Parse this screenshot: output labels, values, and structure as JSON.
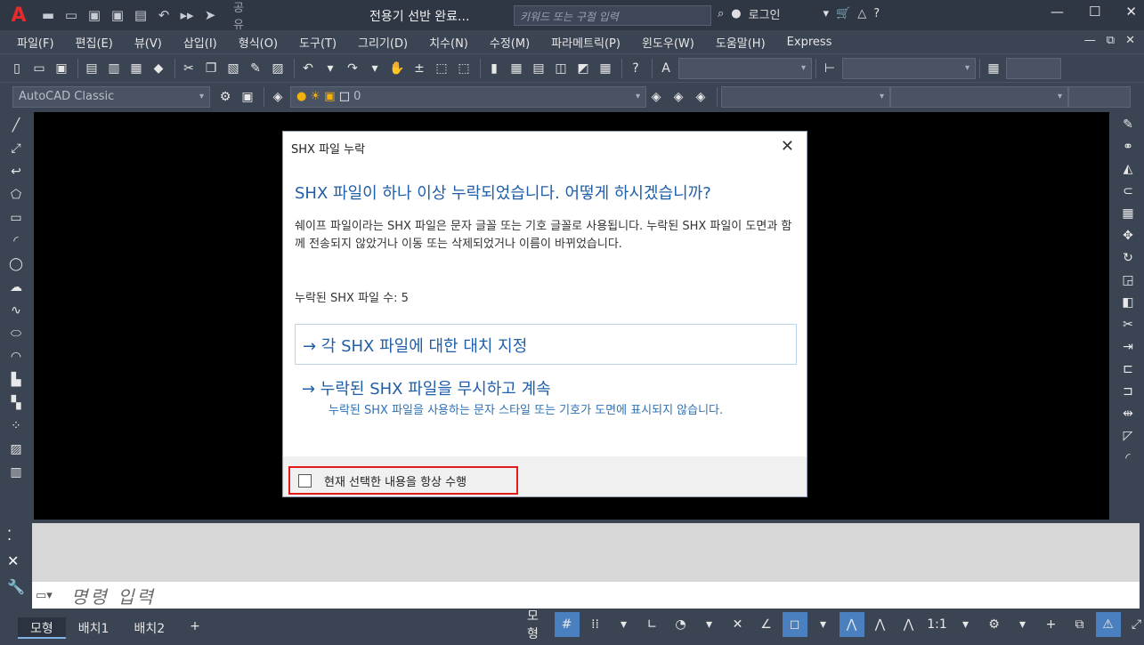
{
  "titlebar": {
    "logo": "A",
    "share": "공유",
    "doc_title": "전용기 선반 완료...",
    "search_placeholder": "키워드 또는 구절 입력",
    "login": "로그인"
  },
  "menu": [
    "파일(F)",
    "편집(E)",
    "뷰(V)",
    "삽입(I)",
    "형식(O)",
    "도구(T)",
    "그리기(D)",
    "치수(N)",
    "수정(M)",
    "파라메트릭(P)",
    "윈도우(W)",
    "도움말(H)",
    "Express"
  ],
  "toolbar": {
    "workspace": "AutoCAD Classic",
    "layer_value": "0"
  },
  "command": {
    "placeholder": "명령 입력"
  },
  "layout_tabs": [
    "모형",
    "배치1",
    "배치2"
  ],
  "status": {
    "model": "모형",
    "scale": "1:1"
  },
  "dialog": {
    "title": "SHX 파일 누락",
    "heading": "SHX 파일이 하나 이상 누락되었습니다. 어떻게 하시겠습니까?",
    "body": "쉐이프 파일이라는 SHX 파일은 문자 글꼴 또는 기호 글꼴로 사용됩니다. 누락된 SHX 파일이 도면과 함께 전송되지 않았거나 이동 또는 삭제되었거나 이름이 바뀌었습니다.",
    "count": "누락된 SHX 파일 수: 5",
    "option1": "→ 각 SHX 파일에 대한 대치 지정",
    "option2": "→ 누락된 SHX 파일을 무시하고 계속",
    "option2_sub": "누락된 SHX 파일을 사용하는 문자 스타일 또는 기호가 도면에 표시되지 않습니다.",
    "checkbox": "현재 선택한 내용을 항상 수행"
  }
}
